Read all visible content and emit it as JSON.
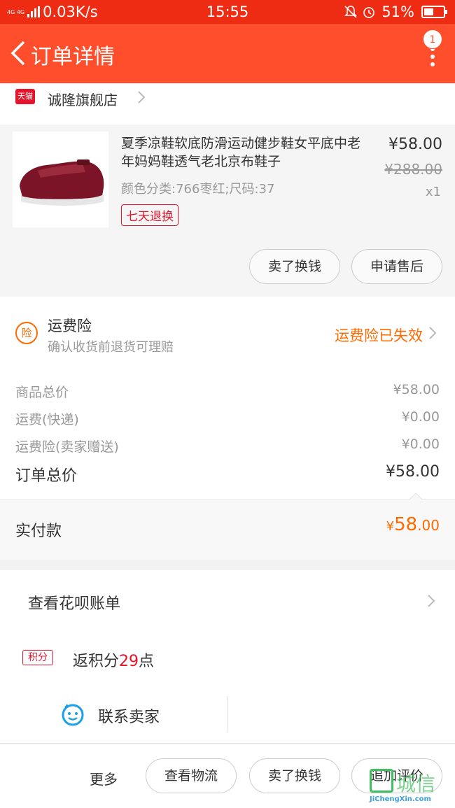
{
  "status_bar": {
    "network": "4G 4G",
    "speed": "0.03K/s",
    "time": "15:55",
    "battery": "51%",
    "battery_level": 0.51
  },
  "header": {
    "title": "订单详情",
    "notification_count": "1"
  },
  "shop": {
    "logo_text": "天猫",
    "name": "诚隆旗舰店"
  },
  "item": {
    "title": "夏季凉鞋软底防滑运动健步鞋女平底中老年妈妈鞋透气老北京布鞋子",
    "spec": "颜色分类:766枣红;尺码:37",
    "tag": "七天退换",
    "price": "¥58.00",
    "original_price": "¥288.00",
    "quantity": "x1",
    "actions": [
      "卖了换钱",
      "申请售后"
    ]
  },
  "insurance": {
    "icon_text": "险",
    "title": "运费险",
    "subtitle": "确认收货前退货可理赔",
    "status": "运费险已失效"
  },
  "summary": {
    "rows": [
      {
        "label": "商品总价",
        "value": "¥58.00"
      },
      {
        "label": "运费(快递)",
        "value": "¥0.00"
      },
      {
        "label": "运费险(卖家赠送)",
        "value": "¥0.00"
      }
    ],
    "total_label": "订单总价",
    "total_value": "¥58.00"
  },
  "paid": {
    "label": "实付款",
    "currency": "¥",
    "integer": "58",
    "decimal": ".00"
  },
  "huabei": {
    "label": "查看花呗账单"
  },
  "points": {
    "badge": "积分",
    "prefix": "返积分",
    "value": "29",
    "suffix": "点"
  },
  "contact": {
    "label": "联系卖家"
  },
  "bottom_bar": {
    "more": "更多",
    "buttons": [
      "查看物流",
      "卖了换钱",
      "追加评价"
    ]
  },
  "watermark": {
    "cn": "城信",
    "en": "JiChengXin.com"
  },
  "colors": {
    "header": "#ff4e2b",
    "accent_orange": "#ff6a00",
    "tmall_red": "#e4162d"
  }
}
